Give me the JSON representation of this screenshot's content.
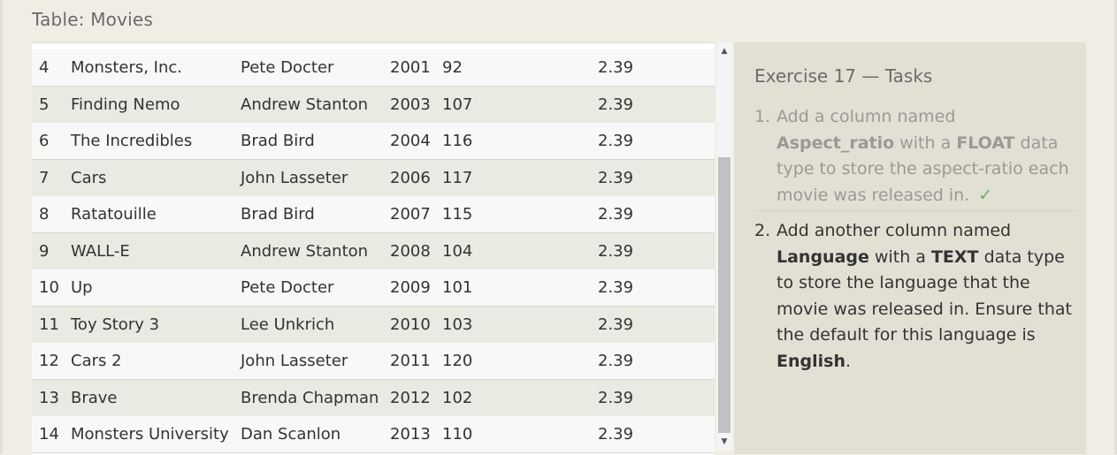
{
  "table_title": "Table: Movies",
  "rows": [
    {
      "id": "4",
      "title": "Monsters, Inc.",
      "director": "Pete Docter",
      "year": "2001",
      "length": "92",
      "aspect_ratio": "2.39"
    },
    {
      "id": "5",
      "title": "Finding Nemo",
      "director": "Andrew Stanton",
      "year": "2003",
      "length": "107",
      "aspect_ratio": "2.39"
    },
    {
      "id": "6",
      "title": "The Incredibles",
      "director": "Brad Bird",
      "year": "2004",
      "length": "116",
      "aspect_ratio": "2.39"
    },
    {
      "id": "7",
      "title": "Cars",
      "director": "John Lasseter",
      "year": "2006",
      "length": "117",
      "aspect_ratio": "2.39"
    },
    {
      "id": "8",
      "title": "Ratatouille",
      "director": "Brad Bird",
      "year": "2007",
      "length": "115",
      "aspect_ratio": "2.39"
    },
    {
      "id": "9",
      "title": "WALL-E",
      "director": "Andrew Stanton",
      "year": "2008",
      "length": "104",
      "aspect_ratio": "2.39"
    },
    {
      "id": "10",
      "title": "Up",
      "director": "Pete Docter",
      "year": "2009",
      "length": "101",
      "aspect_ratio": "2.39"
    },
    {
      "id": "11",
      "title": "Toy Story 3",
      "director": "Lee Unkrich",
      "year": "2010",
      "length": "103",
      "aspect_ratio": "2.39"
    },
    {
      "id": "12",
      "title": "Cars 2",
      "director": "John Lasseter",
      "year": "2011",
      "length": "120",
      "aspect_ratio": "2.39"
    },
    {
      "id": "13",
      "title": "Brave",
      "director": "Brenda Chapman",
      "year": "2012",
      "length": "102",
      "aspect_ratio": "2.39"
    },
    {
      "id": "14",
      "title": "Monsters University",
      "director": "Dan Scanlon",
      "year": "2013",
      "length": "110",
      "aspect_ratio": "2.39"
    }
  ],
  "scrollbar": {
    "up_icon": "scroll-up-arrow",
    "down_icon": "scroll-down-arrow"
  },
  "tasks": {
    "heading": "Exercise 17 — Tasks",
    "items": [
      {
        "number": "1.",
        "status": "done",
        "t1": "Add a column named ",
        "b1": "Aspect_ratio",
        "t2": " with a ",
        "b2": "FLOAT",
        "t3": " data type to store the aspect-ratio each movie was released in.",
        "check": "✓"
      },
      {
        "number": "2.",
        "status": "active",
        "t1": "Add another column named ",
        "b1": "Language",
        "t2": " with a ",
        "b2": "TEXT",
        "t3": " data type to store the language that the movie was released in. Ensure that the default for this language is ",
        "b3": "English",
        "t4": "."
      }
    ]
  },
  "colors": {
    "background": "#f0ede5",
    "row_odd": "#f8f8f8",
    "row_even": "#eae9e2",
    "task_panel": "#e2e0d3",
    "check": "#5cb85c"
  }
}
